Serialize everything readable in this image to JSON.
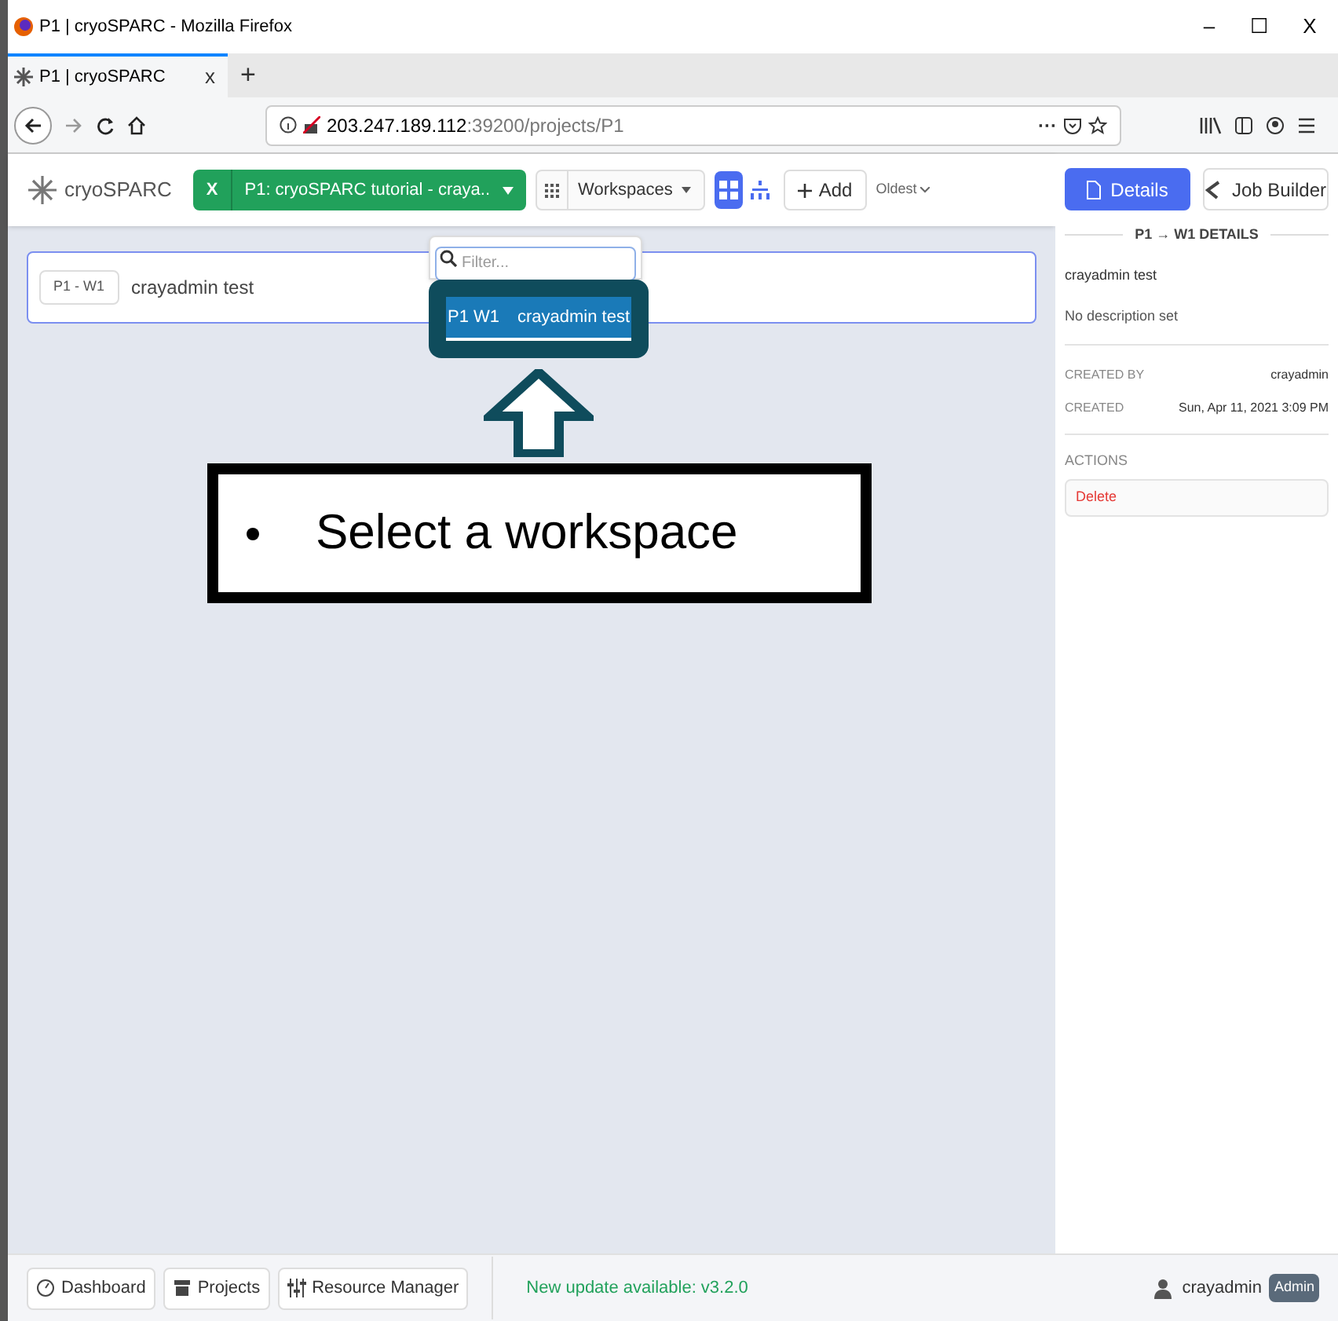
{
  "window": {
    "title": "P1 | cryoSPARC - Mozilla Firefox",
    "controls": [
      "–",
      "☐",
      "X"
    ]
  },
  "browser_tab": {
    "label": "P1 | cryoSPARC",
    "close": "x",
    "new_tab": "+"
  },
  "address_bar": {
    "host": "203.247.189.112",
    "path": ":39200/projects/P1",
    "more": "···"
  },
  "header": {
    "logo": "cryoSPARC",
    "project_close": "X",
    "project": "P1: cryoSPARC tutorial - craya..",
    "workspaces": "Workspaces",
    "views": [
      {
        "kind": "grid",
        "selected": true
      },
      {
        "kind": "tree",
        "selected": false
      }
    ],
    "add": "Add",
    "sort": "Oldest"
  },
  "workspace_card": {
    "tag": "P1 - W1",
    "title": "crayadmin test",
    "selected": true
  },
  "dropdown": {
    "placeholder": "Filter...",
    "items": [
      {
        "id": "P1 W1",
        "name": "crayadmin test",
        "selected": true
      }
    ]
  },
  "panel": {
    "tabs": [
      {
        "label": "Details",
        "selected": true
      },
      {
        "label": "Job Builder",
        "selected": false
      }
    ],
    "heading": "P1 → W1 DETAILS",
    "name": "crayadmin test",
    "description": "No description set",
    "fields": [
      {
        "label": "CREATED BY",
        "value": "crayadmin"
      },
      {
        "label": "CREATED",
        "value": "Sun, Apr 11, 2021 3:09 PM"
      }
    ],
    "actions_label": "ACTIONS",
    "delete": "Delete"
  },
  "footer": {
    "nav": [
      "Dashboard",
      "Projects",
      "Resource Manager"
    ],
    "update": "New update available: v3.2.0",
    "user": "crayadmin",
    "role": "Admin"
  },
  "annotation": {
    "text": "Select a workspace"
  }
}
